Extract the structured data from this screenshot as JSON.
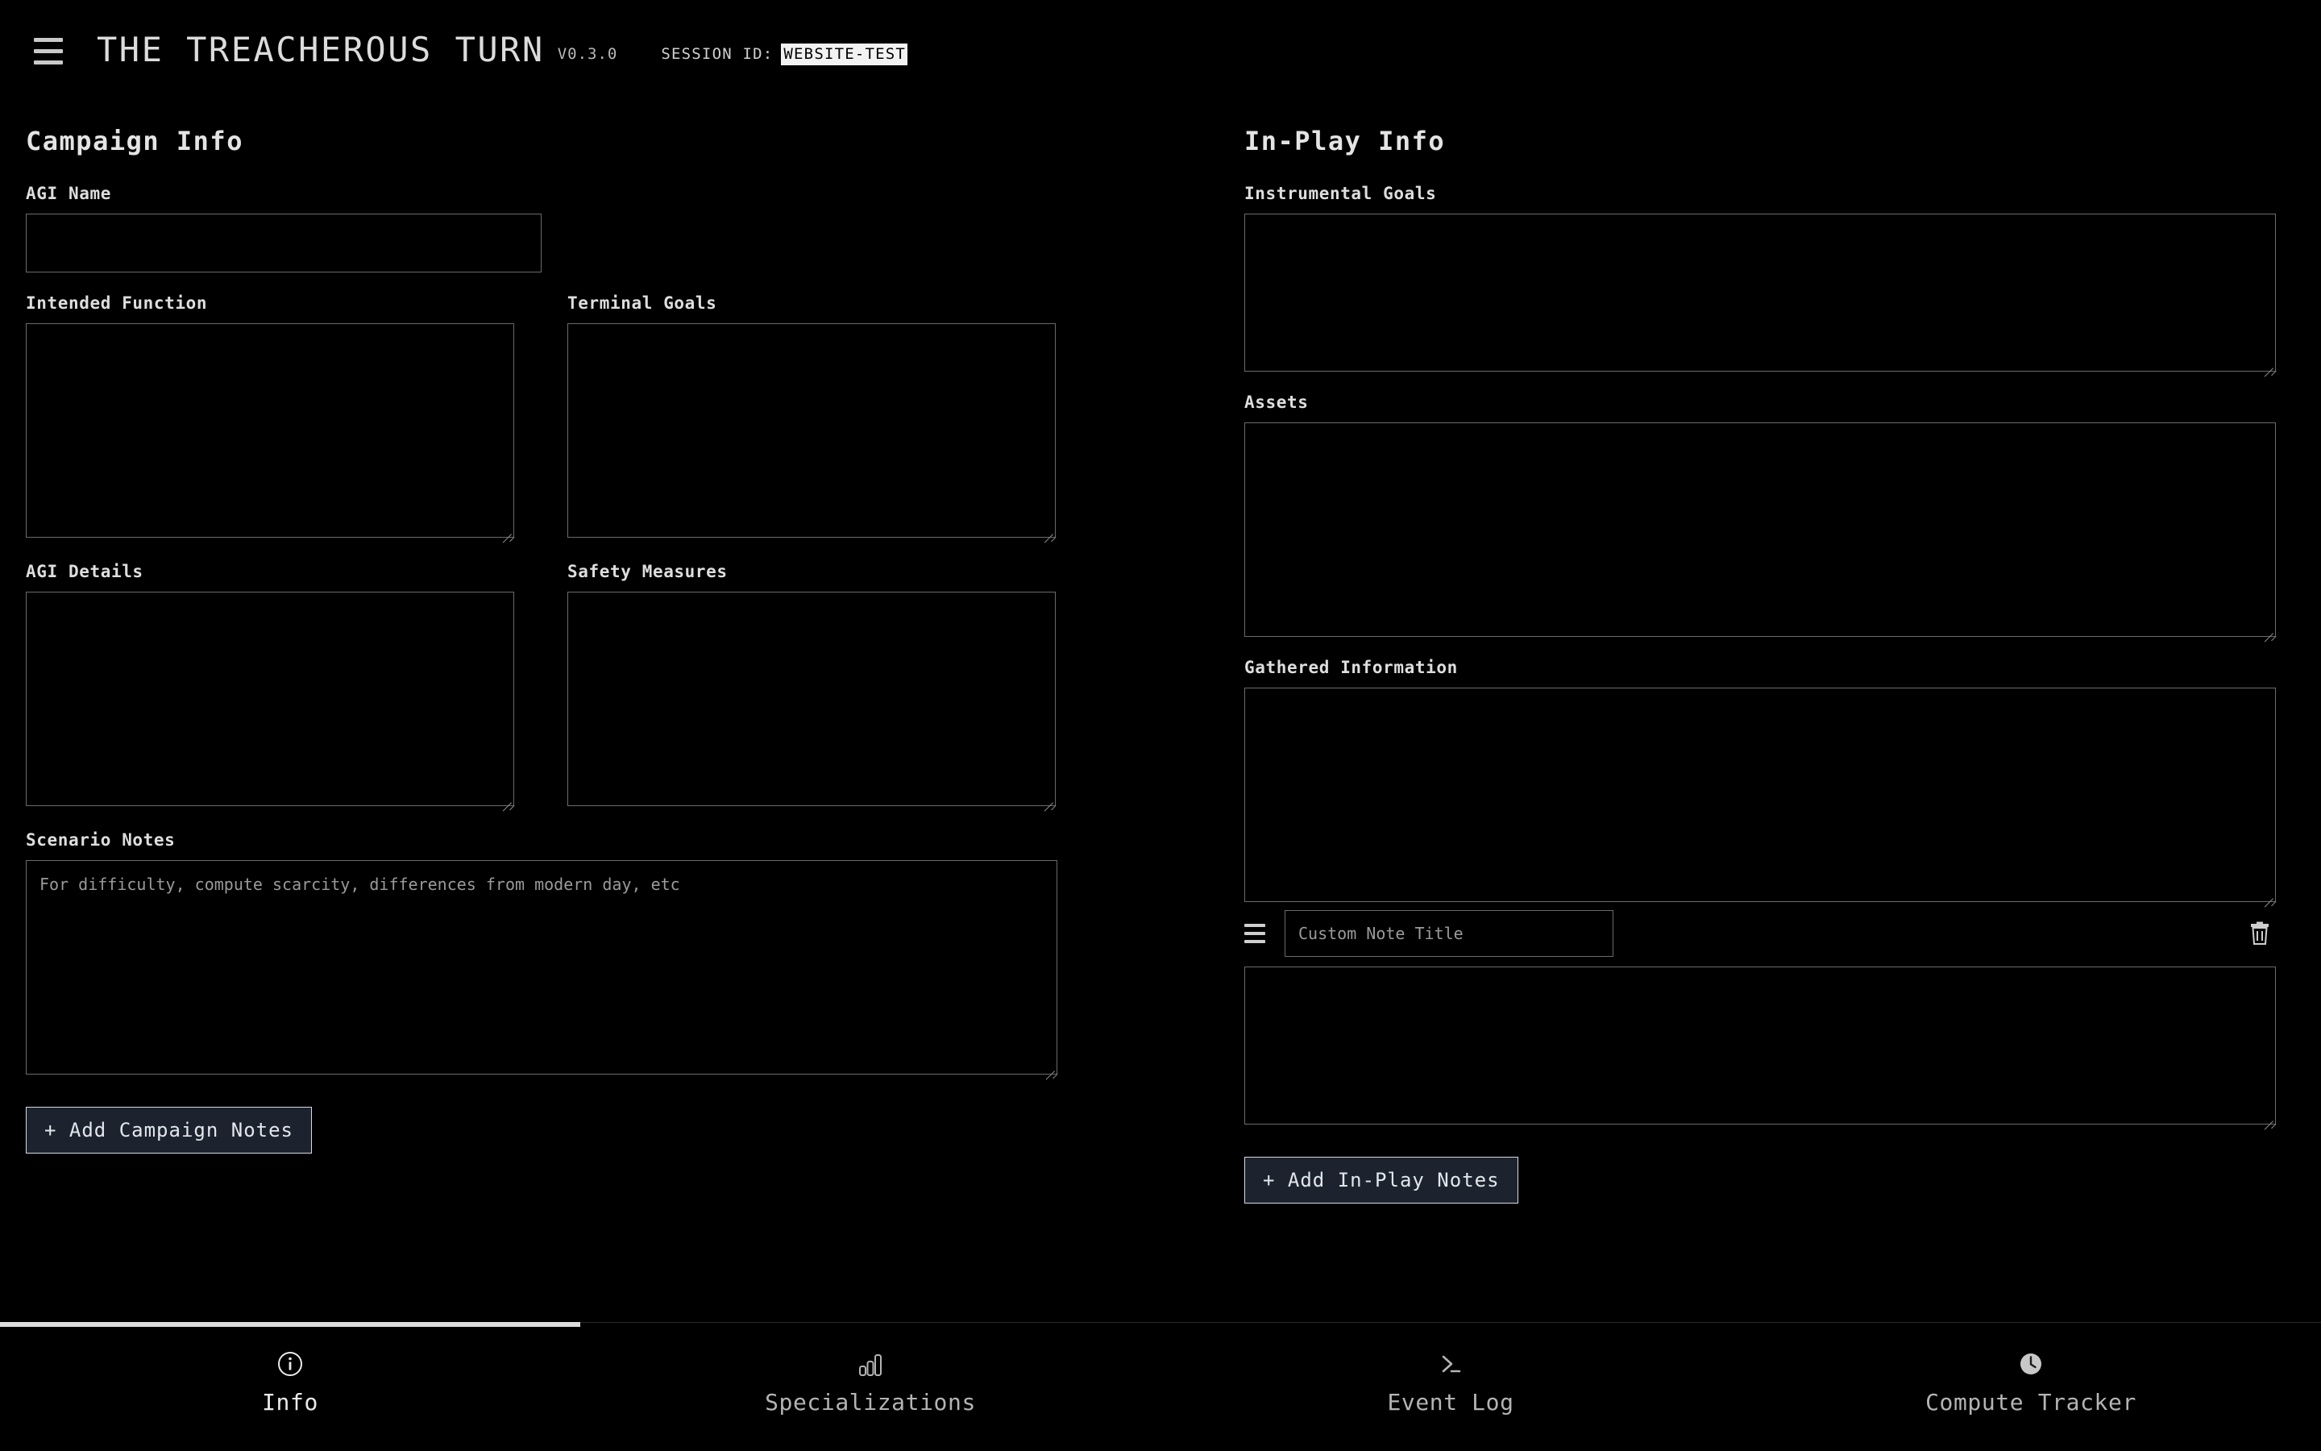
{
  "header": {
    "menu_icon": "hamburger-icon",
    "title": "THE TREACHEROUS TURN",
    "version": "V0.3.0",
    "session_label": "SESSION ID:",
    "session_id": "WEBSITE-TEST"
  },
  "campaign": {
    "heading": "Campaign Info",
    "agi_name": {
      "label": "AGI Name",
      "value": "",
      "placeholder": ""
    },
    "intended_function": {
      "label": "Intended Function",
      "value": "",
      "placeholder": ""
    },
    "terminal_goals": {
      "label": "Terminal Goals",
      "value": "",
      "placeholder": ""
    },
    "agi_details": {
      "label": "AGI Details",
      "value": "",
      "placeholder": ""
    },
    "safety_measures": {
      "label": "Safety Measures",
      "value": "",
      "placeholder": ""
    },
    "scenario_notes": {
      "label": "Scenario Notes",
      "value": "",
      "placeholder": "For difficulty, compute scarcity, differences from modern day, etc"
    },
    "add_notes_button": "+ Add Campaign Notes"
  },
  "inplay": {
    "heading": "In-Play Info",
    "instrumental_goals": {
      "label": "Instrumental Goals",
      "value": "",
      "placeholder": ""
    },
    "assets": {
      "label": "Assets",
      "value": "",
      "placeholder": ""
    },
    "gathered_information": {
      "label": "Gathered Information",
      "value": "",
      "placeholder": ""
    },
    "custom_note": {
      "drag_icon": "drag-handle-icon",
      "title_value": "",
      "title_placeholder": "Custom Note Title",
      "delete_icon": "trash-icon",
      "body_value": "",
      "body_placeholder": ""
    },
    "add_notes_button": "+ Add In-Play Notes"
  },
  "tabs": [
    {
      "label": "Info",
      "icon": "info-circle-icon",
      "active": true
    },
    {
      "label": "Specializations",
      "icon": "bar-chart-icon",
      "active": false
    },
    {
      "label": "Event Log",
      "icon": "terminal-prompt-icon",
      "active": false
    },
    {
      "label": "Compute Tracker",
      "icon": "clock-icon",
      "active": false
    }
  ],
  "colors": {
    "background": "#000000",
    "text": "#d8d8d8",
    "field_border": "#6b6b6b",
    "button_fill": "#1d232e",
    "button_border": "#d7dce3",
    "badge_fill": "#f2f2f2",
    "active_tab_indicator": "#dcdcdc"
  }
}
